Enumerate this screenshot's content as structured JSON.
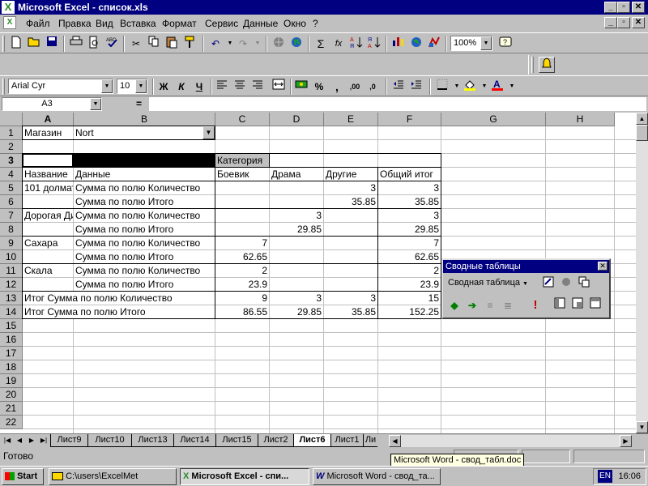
{
  "window": {
    "title": "Microsoft Excel - список.xls",
    "minimize": "_",
    "restore": "▫",
    "close": "✕"
  },
  "menu": [
    "Файл",
    "Правка",
    "Вид",
    "Вставка",
    "Формат",
    "Сервис",
    "Данные",
    "Окно",
    "?"
  ],
  "toolbar_standard": {
    "icons": [
      "new-icon",
      "open-icon",
      "save-icon",
      "print-icon",
      "print-preview-icon",
      "spelling-icon",
      "cut-icon",
      "copy-icon",
      "paste-icon",
      "format-painter-icon",
      "undo-icon",
      "redo-icon",
      "hyperlink-icon",
      "web-toolbar-icon",
      "autosum-icon",
      "function-icon",
      "sort-ascending-icon",
      "sort-descending-icon",
      "chart-wizard-icon",
      "map-icon",
      "drawing-icon",
      "office-assistant-icon"
    ],
    "zoom": "100%",
    "autosum": "Σ",
    "function": "fx"
  },
  "toolbar_formatting": {
    "font": "Arial Cyr",
    "size": "10",
    "bold": "Ж",
    "italic": "К",
    "underline": "Ч",
    "percent": "%",
    "comma": ",",
    "inc_decimal": ",00",
    "dec_decimal": ",0",
    "font_color_letter": "А"
  },
  "formula_bar": {
    "name_box": "A3",
    "equals": "=",
    "content": ""
  },
  "grid": {
    "columns": [
      "A",
      "B",
      "C",
      "D",
      "E",
      "F",
      "G",
      "H"
    ],
    "rows": [
      "1",
      "2",
      "3",
      "4",
      "5",
      "6",
      "7",
      "8",
      "9",
      "10",
      "11",
      "12",
      "13",
      "14",
      "15",
      "16",
      "17",
      "18",
      "19",
      "20",
      "21",
      "22"
    ],
    "cells": {
      "A1": "Магазин",
      "B1": "Nort",
      "C3": "Категория",
      "A4": "Название",
      "B4": "Данные",
      "C4": "Боевик",
      "D4": "Драма",
      "E4": "Другие",
      "F4": "Общий итог",
      "A5": "101 долматинец",
      "B5": "Сумма по полю Количество",
      "E5": "3",
      "F5": "3",
      "B6": "Сумма по полю Итого",
      "E6": "35.85",
      "F6": "35.85",
      "A7": "Дорогая Диана",
      "B7": "Сумма по полю Количество",
      "D7": "3",
      "F7": "3",
      "B8": "Сумма по полю Итого",
      "D8": "29.85",
      "F8": "29.85",
      "A9": "Сахара",
      "B9": "Сумма по полю Количество",
      "C9": "7",
      "F9": "7",
      "B10": "Сумма по полю Итого",
      "C10": "62.65",
      "F10": "62.65",
      "A11": "Скала",
      "B11": "Сумма по полю Количество",
      "C11": "2",
      "F11": "2",
      "B12": "Сумма по полю Итого",
      "C12": "23.9",
      "F12": "23.9",
      "A13": "Итог Сумма по полю Количество",
      "C13": "9",
      "D13": "3",
      "E13": "3",
      "F13": "15",
      "A14": "Итог Сумма по полю Итого",
      "C14": "86.55",
      "D14": "29.85",
      "E14": "35.85",
      "F14": "152.25"
    }
  },
  "sheet_tabs": [
    "Лист9",
    "Лист10",
    "Лист13",
    "Лист14",
    "Лист15",
    "Лист2",
    "Лист6",
    "Лист1",
    "Ли"
  ],
  "active_tab": "Лист6",
  "status": {
    "text": "Готово"
  },
  "tooltip": "Microsoft Word - свод_табл.doc",
  "pivot_toolbar": {
    "title": "Сводные таблицы",
    "menu": "Сводная таблица",
    "close": "✕"
  },
  "taskbar": {
    "start": "Start",
    "items": [
      "C:\\users\\ExcelMet",
      "Microsoft Excel - спи...",
      "Microsoft Word - свод_та..."
    ],
    "lang": "EN",
    "time": "16:06"
  }
}
